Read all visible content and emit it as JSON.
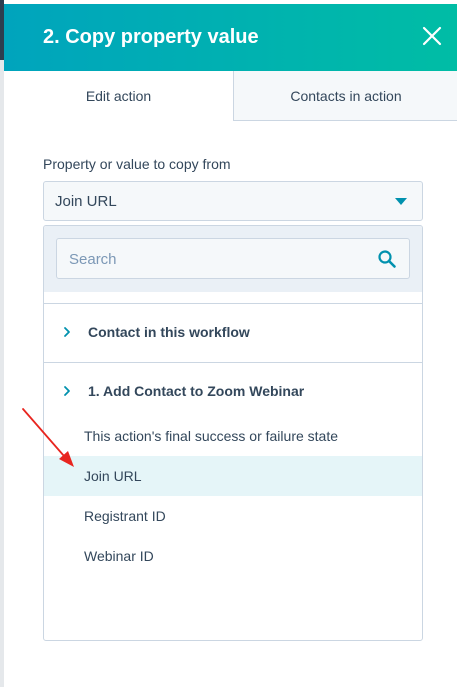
{
  "panel": {
    "title": "2. Copy property value",
    "close_icon": "close-icon"
  },
  "tabs": [
    {
      "label": "Edit action",
      "active": true
    },
    {
      "label": "Contacts in action",
      "active": false
    }
  ],
  "field": {
    "label": "Property or value to copy from",
    "selected_value": "Join URL"
  },
  "dropdown": {
    "search_placeholder": "Search",
    "groups": [
      {
        "label": "Contact in this workflow",
        "expanded": false
      },
      {
        "label": "1. Add Contact to Zoom Webinar",
        "expanded": true,
        "options": [
          {
            "label": "This action's final success or failure state",
            "selected": false
          },
          {
            "label": "Join URL",
            "selected": true
          },
          {
            "label": "Registrant ID",
            "selected": false
          },
          {
            "label": "Webinar ID",
            "selected": false
          }
        ]
      }
    ]
  },
  "colors": {
    "header_gradient_start": "#00a4bd",
    "header_gradient_end": "#00bda5",
    "accent": "#0091ae",
    "selected_row": "#e5f5f8",
    "annotation_arrow": "#e8251f"
  }
}
